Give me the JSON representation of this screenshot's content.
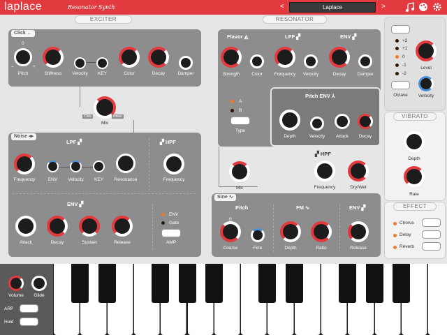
{
  "app": {
    "brand": "laplace",
    "subtitle": "Resonator Synth",
    "preset": "Laplace",
    "prev": "<",
    "next": ">"
  },
  "headings": {
    "exciter": "EXCITER",
    "resonator": "RESONATOR",
    "vibrato": "VIBRATO",
    "effect": "EFFECT"
  },
  "click": {
    "tab": "Click",
    "pitch": "Pitch",
    "stiffness": "Stiffness",
    "velocity": "Velocity",
    "key": "KEY",
    "color": "Color",
    "decay": "Decay",
    "damper": "Damper",
    "scale0": "0",
    "minus": "–",
    "plus": "+"
  },
  "mix": {
    "label": "Mix",
    "left": "Click",
    "right": "Noise"
  },
  "noise": {
    "tab": "Noise",
    "lpf": "LPF",
    "hpf": "HPF",
    "frequency": "Frequency",
    "env": "ENV",
    "velocity": "Velocity",
    "key": "KEY",
    "resonance": "Resonance",
    "hpf_frequency": "Frequency",
    "env_title": "ENV",
    "attack": "Attack",
    "decay": "Decay",
    "sustain": "Sustain",
    "release": "Release",
    "opt_env": "ENV",
    "opt_gate": "Gate",
    "amp": "AMP"
  },
  "resonator": {
    "flavor": "Flavor",
    "lpf": "LPF",
    "env": "ENV",
    "strength": "Strength",
    "color": "Color",
    "frequency": "Frequency",
    "velocity": "Velocity",
    "decay": "Decay",
    "damper": "Damper",
    "type_a": "A",
    "type_b": "B",
    "type": "Type",
    "pitch_env": "Pitch ENV",
    "depth": "Depth",
    "pe_velocity": "Velocity",
    "attack": "Attack",
    "pe_decay": "Decay",
    "mix": "Mix",
    "hpf": "HPF",
    "hpf_frequency": "Frequency",
    "drywet": "Dry/Wet"
  },
  "sine": {
    "tab": "Sine",
    "pitch": "Pitch",
    "fm": "FM",
    "env": "ENV",
    "coarse": "Coarse",
    "fine": "Fine",
    "depth": "Depth",
    "ratio": "Ratio",
    "release": "Release",
    "scale0": "0"
  },
  "octave": {
    "items": [
      "+2",
      "+1",
      "0",
      "-1",
      "-2"
    ],
    "label": "Octave",
    "level": "Level",
    "velocity": "Velocity"
  },
  "vibrato": {
    "depth": "Depth",
    "rate": "Rate"
  },
  "effect": {
    "chorus": "Chorus",
    "delay": "Delay",
    "reverb": "Reverb"
  },
  "keyboard": {
    "volume": "Volume",
    "glide": "Glide",
    "arp": "ARP",
    "hold": "Hold"
  },
  "colors": {
    "accent": "#e23a3f",
    "active": "#f07a2a",
    "blue": "#4a90d9"
  }
}
